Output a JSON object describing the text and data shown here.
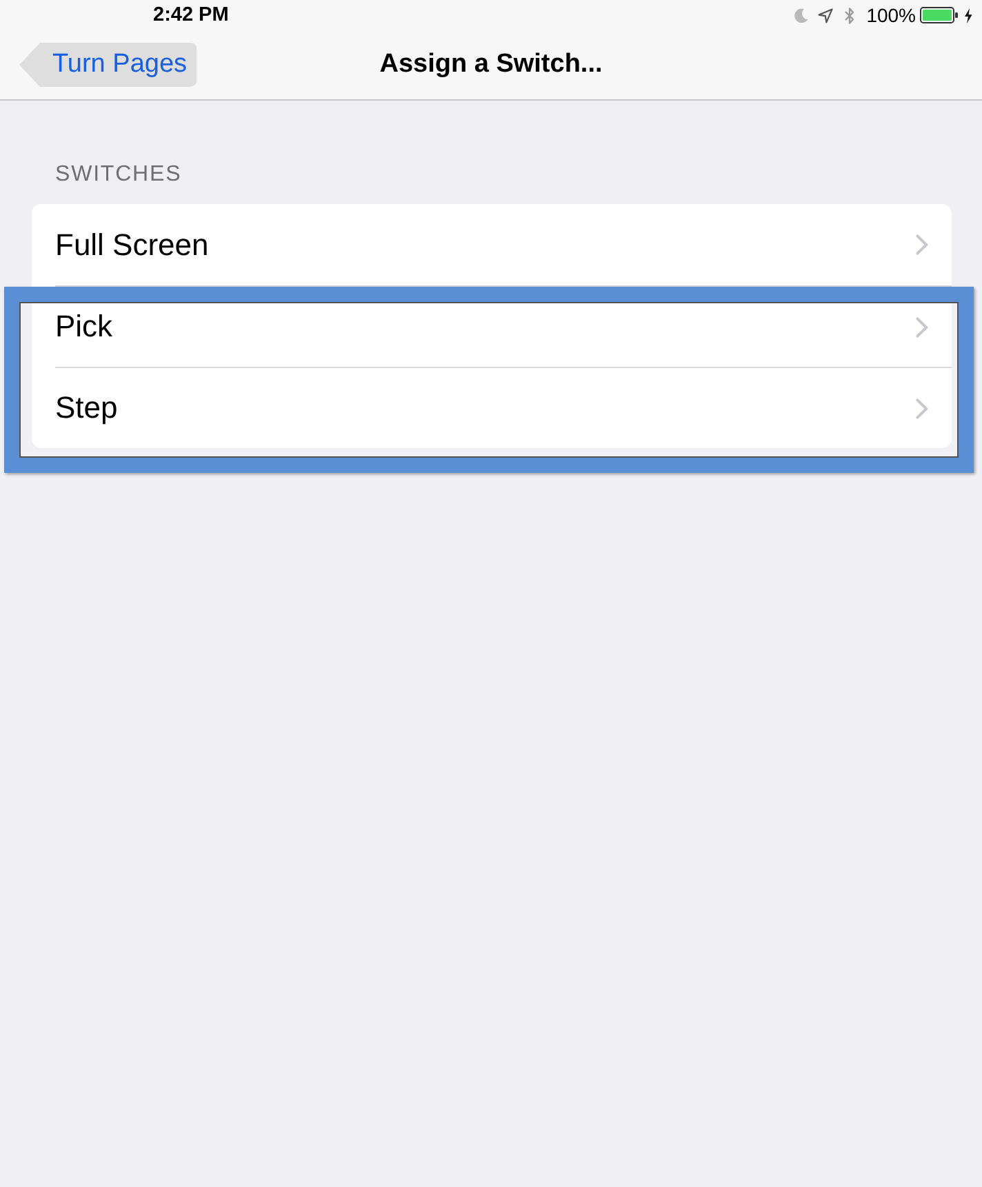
{
  "status_bar": {
    "time": "2:42 PM",
    "battery": "100%"
  },
  "nav_bar": {
    "back_button": "Turn Pages",
    "title": "Assign a Switch..."
  },
  "switches": {
    "header": "SWITCHES",
    "items": [
      {
        "label": "Full Screen",
        "highlighted": false
      },
      {
        "label": "Pick",
        "highlighted": true
      },
      {
        "label": "Step",
        "highlighted": true
      }
    ]
  }
}
